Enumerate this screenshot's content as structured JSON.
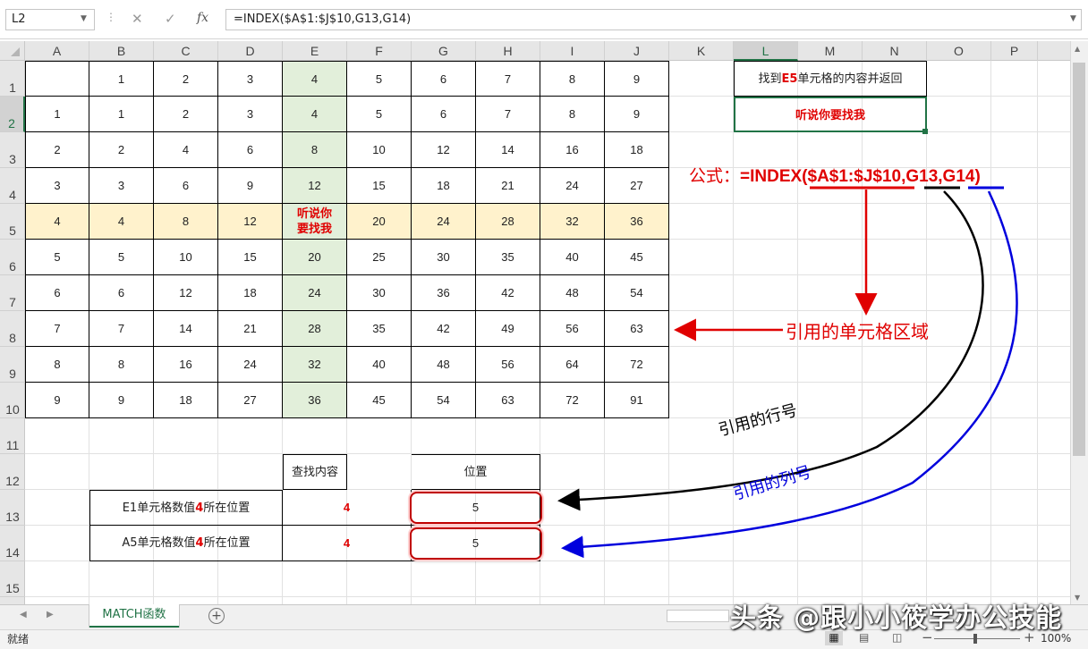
{
  "formula_bar": {
    "name_box": "L2",
    "fx_label": "fx",
    "formula": "=INDEX($A$1:$J$10,G13,G14)"
  },
  "columns": [
    "A",
    "B",
    "C",
    "D",
    "E",
    "F",
    "G",
    "H",
    "I",
    "J",
    "K",
    "L",
    "M",
    "N",
    "O",
    "P"
  ],
  "rows": [
    "1",
    "2",
    "3",
    "4",
    "5",
    "6",
    "7",
    "8",
    "9",
    "10",
    "11",
    "12",
    "13",
    "14",
    "15"
  ],
  "table": [
    [
      "",
      "1",
      "2",
      "3",
      "4",
      "5",
      "6",
      "7",
      "8",
      "9"
    ],
    [
      "1",
      "1",
      "2",
      "3",
      "4",
      "5",
      "6",
      "7",
      "8",
      "9"
    ],
    [
      "2",
      "2",
      "4",
      "6",
      "8",
      "10",
      "12",
      "14",
      "16",
      "18"
    ],
    [
      "3",
      "3",
      "6",
      "9",
      "12",
      "15",
      "18",
      "21",
      "24",
      "27"
    ],
    [
      "4",
      "4",
      "8",
      "12",
      "听说你要找我",
      "20",
      "24",
      "28",
      "32",
      "36"
    ],
    [
      "5",
      "5",
      "10",
      "15",
      "20",
      "25",
      "30",
      "35",
      "40",
      "45"
    ],
    [
      "6",
      "6",
      "12",
      "18",
      "24",
      "30",
      "36",
      "42",
      "48",
      "54"
    ],
    [
      "7",
      "7",
      "14",
      "21",
      "28",
      "35",
      "42",
      "49",
      "56",
      "63"
    ],
    [
      "8",
      "8",
      "16",
      "24",
      "32",
      "40",
      "48",
      "56",
      "64",
      "72"
    ],
    [
      "9",
      "9",
      "18",
      "27",
      "36",
      "45",
      "54",
      "63",
      "72",
      "91"
    ]
  ],
  "e5_line1": "听说你",
  "e5_line2": "要找我",
  "side_box": {
    "prefix": "找到",
    "ref": "E5",
    "suffix": "单元格的内容并返回",
    "result": "听说你要找我"
  },
  "lookup": {
    "header_content": "查找内容",
    "header_position": "位置",
    "row1_pre": "E1单元格数值",
    "row1_num": "4",
    "row1_post": "所在位置",
    "row1_value": "4",
    "row1_pos": "5",
    "row2_pre": "A5单元格数值",
    "row2_num": "4",
    "row2_post": "所在位置",
    "row2_value": "4",
    "row2_pos": "5"
  },
  "annotations": {
    "formula_label": "公式：",
    "formula_text": "=INDEX($A$1:$J$10,G13,G14)",
    "range_label": "引用的单元格区域",
    "row_label": "引用的行号",
    "col_label": "引用的列号"
  },
  "sheet_tab": "MATCH函数",
  "status": "就绪",
  "zoom": "100%",
  "watermark": "头条 @跟小小筱学办公技能",
  "colors": {
    "accent": "#217346",
    "red": "#e00000",
    "blue": "#0000dd",
    "e_col": "#e2efda",
    "row5": "#fff2cc"
  }
}
